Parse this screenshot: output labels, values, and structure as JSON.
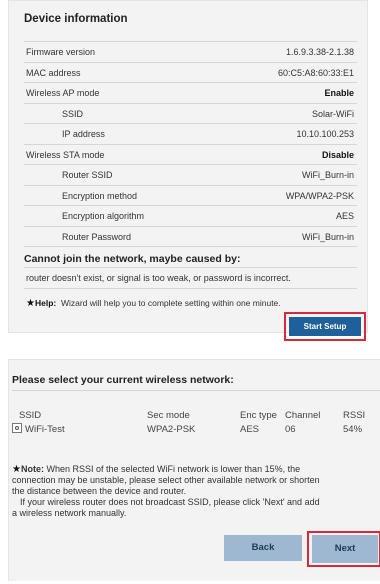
{
  "device_panel": {
    "title": "Device information",
    "rows": [
      {
        "label": "Firmware version",
        "value": "1.6.9.3.38-2.1.38",
        "bold": false,
        "indent": false
      },
      {
        "label": "MAC address",
        "value": "60:C5:A8:60:33:E1",
        "bold": false,
        "indent": false
      },
      {
        "label": "Wireless AP mode",
        "value": "Enable",
        "bold": true,
        "indent": false
      },
      {
        "label": "SSID",
        "value": "Solar-WiFi",
        "bold": false,
        "indent": true
      },
      {
        "label": "IP address",
        "value": "10.10.100.253",
        "bold": false,
        "indent": true
      },
      {
        "label": "Wireless STA mode",
        "value": "Disable",
        "bold": true,
        "indent": false
      },
      {
        "label": "Router SSID",
        "value": "WiFi_Burn-in",
        "bold": false,
        "indent": true
      },
      {
        "label": "Encryption method",
        "value": "WPA/WPA2-PSK",
        "bold": false,
        "indent": true
      },
      {
        "label": "Encryption algorithm",
        "value": "AES",
        "bold": false,
        "indent": true
      },
      {
        "label": "Router Password",
        "value": "WiFi_Burn-in",
        "bold": false,
        "indent": true
      }
    ],
    "cannot_join_title": "Cannot join the network, maybe caused by:",
    "cannot_join_text": "router doesn't exist, or signal is too weak, or password is incorrect.",
    "help_star": "★",
    "help_label": "Help:",
    "help_text": "Wizard will help you to complete setting within one minute.",
    "start_setup_label": "Start Setup"
  },
  "network_panel": {
    "title": "Please select your current wireless network:",
    "columns": {
      "ssid": "SSID",
      "sec": "Sec mode",
      "enc": "Enc type",
      "channel": "Channel",
      "rssi": "RSSI"
    },
    "networks": [
      {
        "ssid": "WiFi-Test",
        "sec": "WPA2-PSK",
        "enc": "AES",
        "channel": "06",
        "rssi": "54%"
      }
    ],
    "note_star": "★",
    "note_label": "Note:",
    "note_line1": "When RSSI of the selected WiFi network is lower than 15%, the",
    "note_line2": "connection may be unstable, please select other available network or shorten",
    "note_line3": "the distance between the device and router.",
    "note_line4": "If your wireless router does not broadcast SSID, please click 'Next' and add",
    "note_line5": "a wireless network manually.",
    "back_label": "Back",
    "next_label": "Next"
  },
  "colors": {
    "panel_bg": "#f3f3f3",
    "setup_button_bg": "#1f5f9a",
    "nav_button_bg": "#9eb8d2",
    "highlight_border": "#d8283a"
  }
}
